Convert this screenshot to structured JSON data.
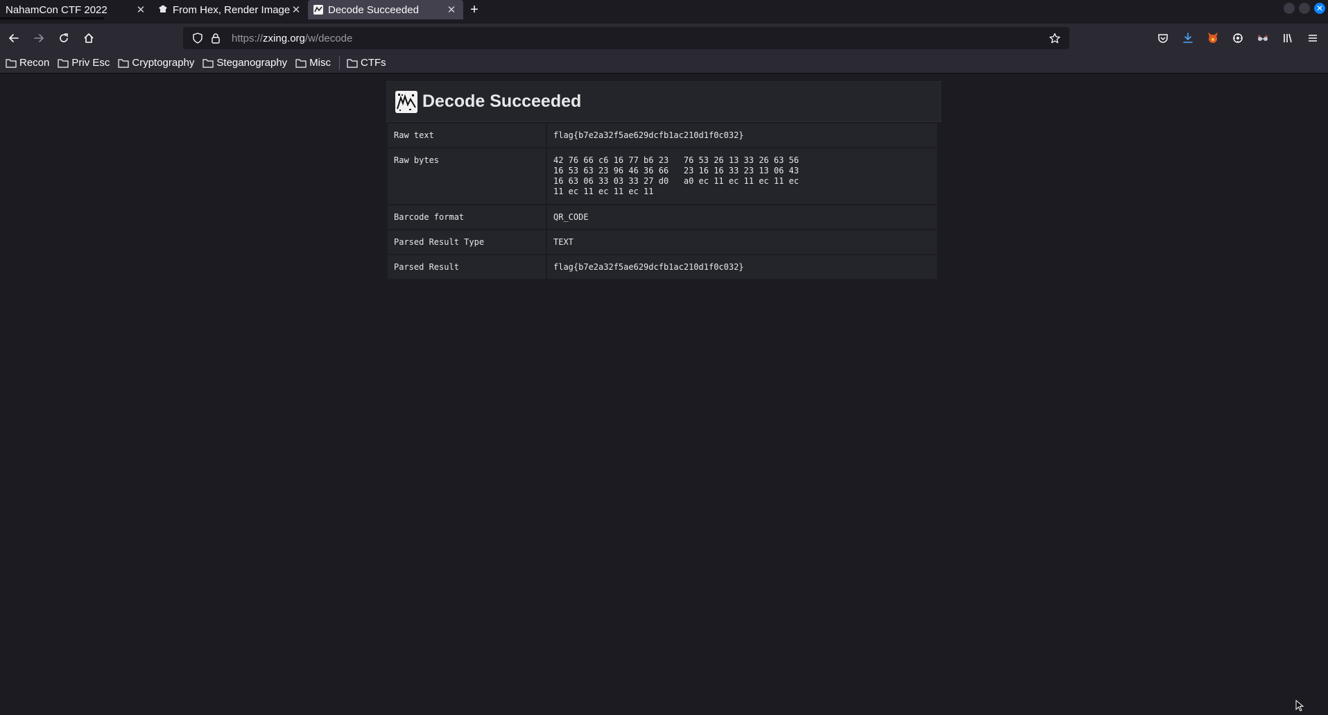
{
  "tabs": [
    {
      "title": "NahamCon CTF 2022",
      "selected": false
    },
    {
      "title": "From Hex, Render Image",
      "selected": false
    },
    {
      "title": "Decode Succeeded",
      "selected": true
    }
  ],
  "close_glyph": "✕",
  "new_tab_glyph": "+",
  "url": {
    "scheme": "https://",
    "host": "zxing.org",
    "path": "/w/decode"
  },
  "bookmarks": [
    {
      "label": "Recon",
      "icon": "folder-icon"
    },
    {
      "label": "Priv Esc",
      "icon": "folder-icon"
    },
    {
      "label": "Cryptography",
      "icon": "folder-icon"
    },
    {
      "label": "Steganography",
      "icon": "folder-icon"
    },
    {
      "label": "Misc",
      "icon": "folder-icon"
    },
    {
      "label": "CTFs",
      "icon": "folder-icon"
    }
  ],
  "page": {
    "title": "Decode Succeeded",
    "rows": [
      {
        "key": "Raw text",
        "value": "flag{b7e2a32f5ae629dcfb1ac210d1f0c032}"
      },
      {
        "key": "Raw bytes",
        "value": "42 76 66 c6 16 77 b6 23   76 53 26 13 33 26 63 56\n16 53 63 23 96 46 36 66   23 16 16 33 23 13 06 43\n16 63 06 33 03 33 27 d0   a0 ec 11 ec 11 ec 11 ec\n11 ec 11 ec 11 ec 11"
      },
      {
        "key": "Barcode format",
        "value": "QR_CODE"
      },
      {
        "key": "Parsed Result Type",
        "value": "TEXT"
      },
      {
        "key": "Parsed Result",
        "value": "flag{b7e2a32f5ae629dcfb1ac210d1f0c032}"
      }
    ]
  },
  "colors": {
    "background": "#1c1b22",
    "toolbar": "#2b2a33",
    "selected_tab": "#42414d",
    "panel": "#23252a",
    "accent": "#0a84ff"
  }
}
